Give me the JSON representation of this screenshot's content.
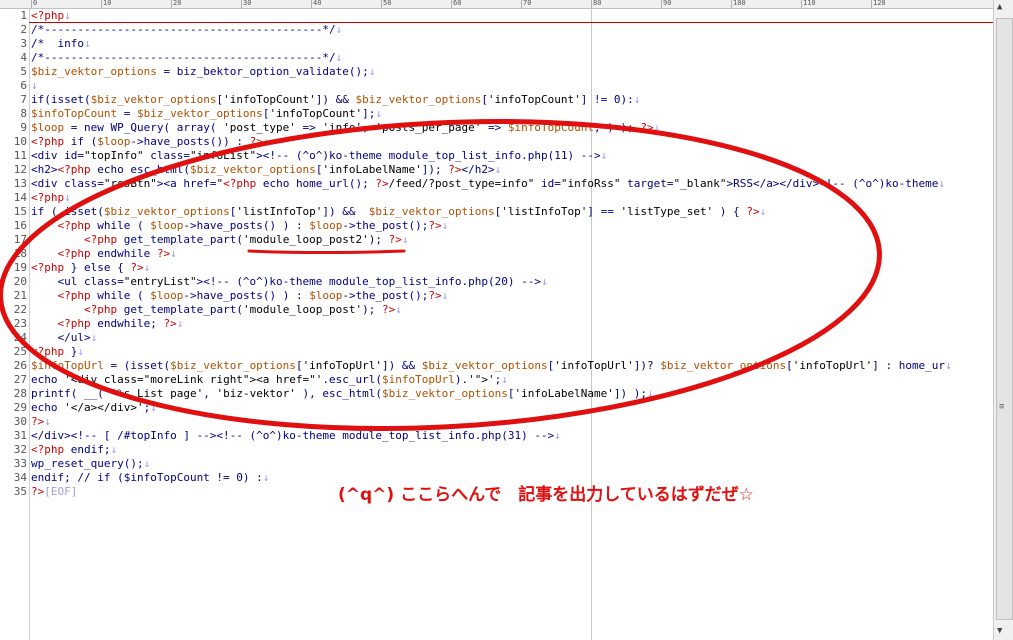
{
  "ruler": {
    "marks": [
      "0",
      "10",
      "20",
      "30",
      "40",
      "50",
      "60",
      "70",
      "80",
      "90",
      "100",
      "110",
      "120"
    ]
  },
  "lines": [
    [
      [
        "php",
        "<?php"
      ]
    ],
    [
      [
        "kw",
        "/*------------------------------------------*/"
      ]
    ],
    [
      [
        "kw",
        "/*  info"
      ]
    ],
    [
      [
        "kw",
        "/*------------------------------------------*/"
      ]
    ],
    [
      [
        "var",
        "$biz_vektor_options"
      ],
      [
        "kw",
        " = biz_bektor_option_validate();"
      ]
    ],
    [],
    [
      [
        "kw",
        "if(isset("
      ],
      [
        "var",
        "$biz_vektor_options"
      ],
      [
        "kw",
        "["
      ],
      [
        "str",
        "'infoTopCount'"
      ],
      [
        "kw",
        "]) && "
      ],
      [
        "var",
        "$biz_vektor_options"
      ],
      [
        "kw",
        "["
      ],
      [
        "str",
        "'infoTopCount'"
      ],
      [
        "kw",
        "] != 0):"
      ]
    ],
    [
      [
        "var",
        "$infoTopCount"
      ],
      [
        "kw",
        " = "
      ],
      [
        "var",
        "$biz_vektor_options"
      ],
      [
        "kw",
        "["
      ],
      [
        "str",
        "'infoTopCount'"
      ],
      [
        "kw",
        "];"
      ]
    ],
    [
      [
        "var",
        "$loop"
      ],
      [
        "kw",
        " = new WP_Query( array( "
      ],
      [
        "str",
        "'post_type'"
      ],
      [
        "kw",
        " => "
      ],
      [
        "str",
        "'info'"
      ],
      [
        "kw",
        ", "
      ],
      [
        "str",
        "'posts_per_page'"
      ],
      [
        "kw",
        " => "
      ],
      [
        "var",
        "$infoTopCount"
      ],
      [
        "kw",
        ", ) ); "
      ],
      [
        "php",
        "?>"
      ]
    ],
    [
      [
        "php",
        "<?php"
      ],
      [
        "kw",
        " if ("
      ],
      [
        "var",
        "$loop"
      ],
      [
        "kw",
        "->have_posts()) : "
      ],
      [
        "php",
        "?>"
      ]
    ],
    [
      [
        "kw",
        "<div id="
      ],
      [
        "str",
        "\"topInfo\""
      ],
      [
        "kw",
        " class="
      ],
      [
        "str",
        "\"infoList\""
      ],
      [
        "kw",
        "><!-- (^o^)ko-theme module_top_list_info.php(11) -->"
      ]
    ],
    [
      [
        "kw",
        "<h2>"
      ],
      [
        "php",
        "<?php"
      ],
      [
        "kw",
        " echo esc_html("
      ],
      [
        "var",
        "$biz_vektor_options"
      ],
      [
        "kw",
        "["
      ],
      [
        "str",
        "'infoLabelName'"
      ],
      [
        "kw",
        "]); "
      ],
      [
        "php",
        "?>"
      ],
      [
        "kw",
        "</h2>"
      ]
    ],
    [
      [
        "kw",
        "<div class="
      ],
      [
        "str",
        "\"rssBtn\""
      ],
      [
        "kw",
        "><a href="
      ],
      [
        "str",
        "\""
      ],
      [
        "php",
        "<?php"
      ],
      [
        "kw",
        " echo home_url(); "
      ],
      [
        "php",
        "?>"
      ],
      [
        "str",
        "/feed/?post_type=info\""
      ],
      [
        "kw",
        " id="
      ],
      [
        "str",
        "\"infoRss\""
      ],
      [
        "kw",
        " target="
      ],
      [
        "str",
        "\"_blank\""
      ],
      [
        "kw",
        ">RSS</a></div><!-- (^o^)ko-theme"
      ]
    ],
    [
      [
        "php",
        "<?php"
      ]
    ],
    [
      [
        "kw",
        "if ( isset("
      ],
      [
        "var",
        "$biz_vektor_options"
      ],
      [
        "kw",
        "["
      ],
      [
        "str",
        "'listInfoTop'"
      ],
      [
        "kw",
        "]) &&  "
      ],
      [
        "var",
        "$biz_vektor_options"
      ],
      [
        "kw",
        "["
      ],
      [
        "str",
        "'listInfoTop'"
      ],
      [
        "kw",
        "] == "
      ],
      [
        "str",
        "'listType_set'"
      ],
      [
        "kw",
        " ) { "
      ],
      [
        "php",
        "?>"
      ]
    ],
    [
      [
        "kw",
        "    "
      ],
      [
        "php",
        "<?php"
      ],
      [
        "kw",
        " while ( "
      ],
      [
        "var",
        "$loop"
      ],
      [
        "kw",
        "->have_posts() ) : "
      ],
      [
        "var",
        "$loop"
      ],
      [
        "kw",
        "->the_post();"
      ],
      [
        "php",
        "?>"
      ]
    ],
    [
      [
        "kw",
        "        "
      ],
      [
        "php",
        "<?php"
      ],
      [
        "kw",
        " get_template_part("
      ],
      [
        "str",
        "'module_loop_post2'"
      ],
      [
        "kw",
        "); "
      ],
      [
        "php",
        "?>"
      ]
    ],
    [
      [
        "kw",
        "    "
      ],
      [
        "php",
        "<?php"
      ],
      [
        "kw",
        " endwhile "
      ],
      [
        "php",
        "?>"
      ]
    ],
    [
      [
        "php",
        "<?php"
      ],
      [
        "kw",
        " } else { "
      ],
      [
        "php",
        "?>"
      ]
    ],
    [
      [
        "kw",
        "    <ul class="
      ],
      [
        "str",
        "\"entryList\""
      ],
      [
        "kw",
        "><!-- (^o^)ko-theme module_top_list_info.php(20) -->"
      ]
    ],
    [
      [
        "kw",
        "    "
      ],
      [
        "php",
        "<?php"
      ],
      [
        "kw",
        " while ( "
      ],
      [
        "var",
        "$loop"
      ],
      [
        "kw",
        "->have_posts() ) : "
      ],
      [
        "var",
        "$loop"
      ],
      [
        "kw",
        "->the_post();"
      ],
      [
        "php",
        "?>"
      ]
    ],
    [
      [
        "kw",
        "        "
      ],
      [
        "php",
        "<?php"
      ],
      [
        "kw",
        " get_template_part("
      ],
      [
        "str",
        "'module_loop_post'"
      ],
      [
        "kw",
        "); "
      ],
      [
        "php",
        "?>"
      ]
    ],
    [
      [
        "kw",
        "    "
      ],
      [
        "php",
        "<?php"
      ],
      [
        "kw",
        " endwhile; "
      ],
      [
        "php",
        "?>"
      ]
    ],
    [
      [
        "kw",
        "    </ul>"
      ]
    ],
    [
      [
        "php",
        "<?php"
      ],
      [
        "kw",
        " }"
      ]
    ],
    [
      [
        "var",
        "$infoTopUrl"
      ],
      [
        "kw",
        " = (isset("
      ],
      [
        "var",
        "$biz_vektor_options"
      ],
      [
        "kw",
        "["
      ],
      [
        "str",
        "'infoTopUrl'"
      ],
      [
        "kw",
        "]) && "
      ],
      [
        "var",
        "$biz_vektor_options"
      ],
      [
        "kw",
        "["
      ],
      [
        "str",
        "'infoTopUrl'"
      ],
      [
        "kw",
        "])? "
      ],
      [
        "var",
        "$biz_vektor_options"
      ],
      [
        "kw",
        "["
      ],
      [
        "str",
        "'infoTopUrl'"
      ],
      [
        "kw",
        "] : home_ur"
      ]
    ],
    [
      [
        "kw",
        "echo "
      ],
      [
        "str",
        "'<div class=\"moreLink right\"><a href=\"'"
      ],
      [
        "kw",
        ".esc_url("
      ],
      [
        "var",
        "$infoTopUrl"
      ],
      [
        "kw",
        ")."
      ],
      [
        "str",
        "'\">'"
      ],
      [
        "kw",
        ";"
      ]
    ],
    [
      [
        "kw",
        "printf( __( "
      ],
      [
        "str",
        "'%s List page'"
      ],
      [
        "kw",
        ", "
      ],
      [
        "str",
        "'biz-vektor'"
      ],
      [
        "kw",
        " ), esc_html("
      ],
      [
        "var",
        "$biz_vektor_options"
      ],
      [
        "kw",
        "["
      ],
      [
        "str",
        "'infoLabelName'"
      ],
      [
        "kw",
        "]) );"
      ]
    ],
    [
      [
        "kw",
        "echo "
      ],
      [
        "str",
        "'</a></div>'"
      ],
      [
        "kw",
        ";"
      ]
    ],
    [
      [
        "php",
        "?>"
      ]
    ],
    [
      [
        "kw",
        "</div><!-- [ /#topInfo ] --><!-- (^o^)ko-theme module_top_list_info.php(31) -->"
      ]
    ],
    [
      [
        "php",
        "<?php"
      ],
      [
        "kw",
        " endif;"
      ]
    ],
    [
      [
        "kw",
        "wp_reset_query();"
      ]
    ],
    [
      [
        "kw",
        "endif; // if ($infoTopCount != 0) :"
      ]
    ],
    [
      [
        "php",
        "?>"
      ],
      [
        "eof",
        "[EOF]"
      ]
    ]
  ],
  "eol_marker": "↓",
  "tab_marker": "→",
  "annotation": {
    "text": "(^q^) ここらへんで　記事を出力しているはずだぜ☆",
    "color": "#e01010"
  },
  "scrollbar": {
    "up_arrow": "▲",
    "down_arrow": "▼",
    "grip": "≡"
  }
}
